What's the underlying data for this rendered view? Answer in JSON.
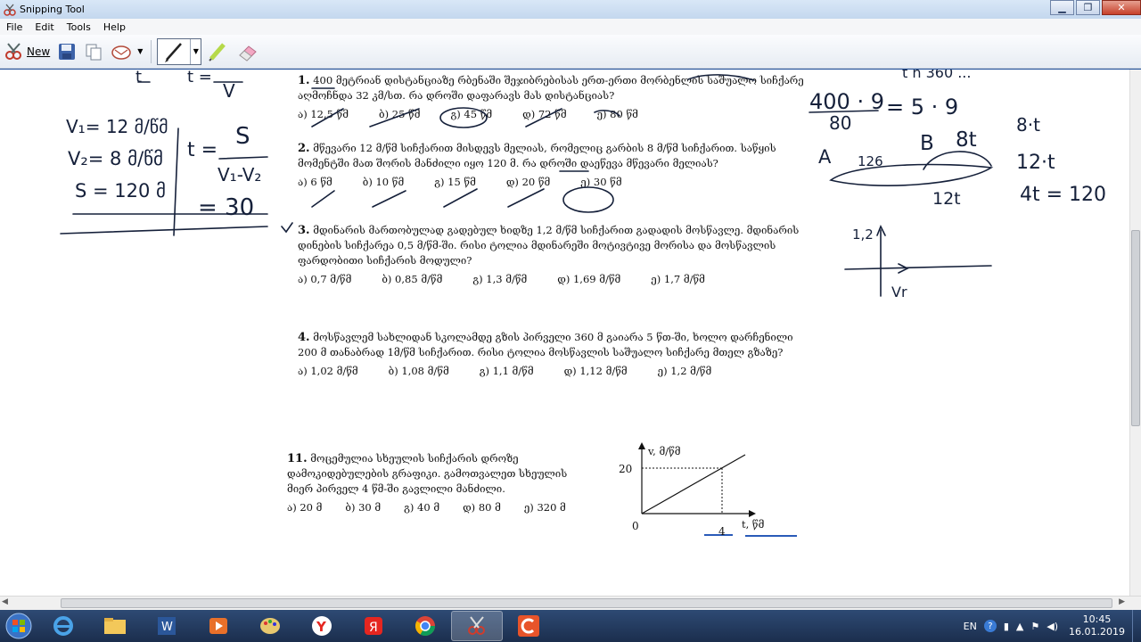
{
  "window": {
    "title": "Snipping Tool",
    "min": "▁",
    "max": "❐",
    "close": "✕"
  },
  "menu": [
    "File",
    "Edit",
    "Tools",
    "Help"
  ],
  "toolbar": {
    "new_label": "New"
  },
  "questions": [
    {
      "num": "1.",
      "text": "400 მეტრიან დისტანციაზე რბენაში შეჯიბრებისას ერთ-ერთი მორბენლის საშუალო სიჩქარე აღმოჩნდა 32 კმ/სთ. რა დროში დაფარავს მას დისტანციას?",
      "opts": [
        "ა)  12,5 წმ",
        "ბ)  25 წმ",
        "გ)  45 წმ",
        "დ)  72 წმ",
        "ე)  80 წმ"
      ]
    },
    {
      "num": "2.",
      "text": "მწევარი 12 მ/წმ სიჩქარით მისდევს მელიას, რომელიც გარბის 8 მ/წმ სიჩქარით. საწყის მომენტში მათ შორის მანძილი იყო 120 მ. რა დროში დაეწევა მწევარი მელიას?",
      "opts": [
        "ა)  6 წმ",
        "ბ)  10 წმ",
        "გ)  15 წმ",
        "დ)  20 წმ",
        "ე)  30 წმ"
      ]
    },
    {
      "num": "3.",
      "text": "მდინარის მართობულად გადებულ ხიდზე 1,2 მ/წმ სიჩქარით გადადის მოსწავლე. მდინარის დინების სიჩქარეა 0,5 მ/წმ-ში. რისი ტოლია მდინარეში მოტივტივე მორისა და მოსწავლის ფარდობითი სიჩქარის მოდული?",
      "opts": [
        "ა)  0,7 მ/წმ",
        "ბ)  0,85 მ/წმ",
        "გ)  1,3 მ/წმ",
        "დ)  1,69 მ/წმ",
        "ე)  1,7 მ/წმ"
      ]
    },
    {
      "num": "4.",
      "text": "მოსწავლემ სახლიდან სკოლამდე გზის პირველი 360 მ  გაიარა 5 წთ-ში,  ხოლო დარჩენილი 200 მ თანაბრად  1მ/წმ სიჩქარით. რისი ტოლია მოსწავლის საშუალო სიჩქარე მთელ გზაზე?",
      "opts": [
        "ა)  1,02 მ/წმ",
        "ბ)  1,08 მ/წმ",
        "გ)  1,1 მ/წმ",
        "დ)  1,12 მ/წმ",
        "ე)  1,2 მ/წმ"
      ]
    },
    {
      "num": "11.",
      "text": "მოცემულია სხეულის სიჩქარის დროზე დამოკიდებულების გრაფიკი. გამოთვალეთ სხეულის მიერ პირველ 4 წმ-ში გავლილი მანძილი.",
      "opts": [
        "ა)  20 მ",
        "ბ)  30 მ",
        "გ)  40 მ",
        "დ)  80 მ",
        "ე)  320 მ"
      ]
    }
  ],
  "graph": {
    "ylabel": "v, მ/წმ",
    "xlabel": "t, წმ",
    "y20": "20",
    "x0": "0",
    "x4": "4"
  },
  "handwriting": {
    "v1": "V₁= 12 მ/წმ",
    "v2": "V₂= 8 მ/წმ",
    "s": "S = 120 მ",
    "t_formula": "t =",
    "t_num": "S",
    "t_den": "V₁-V₂",
    "result": "= 30",
    "top_left1": "t",
    "top_left2": "t =",
    "top_left3": "V",
    "frac_num": "400 · 9",
    "frac_den": "80",
    "frac_eq": "= 5 · 9",
    "pt_a": "A",
    "pt_b": "B",
    "d126": "126",
    "d8t": "8t",
    "d12t": "12t",
    "eq1": "8·t",
    "eq2": "12·t",
    "eq3": "4t = 120",
    "v_12": "1,2",
    "v_r": "Vr",
    "topright": "t n   360   ..."
  },
  "taskbar": {
    "lang": "EN",
    "time": "10:45",
    "date": "16.01.2019"
  }
}
